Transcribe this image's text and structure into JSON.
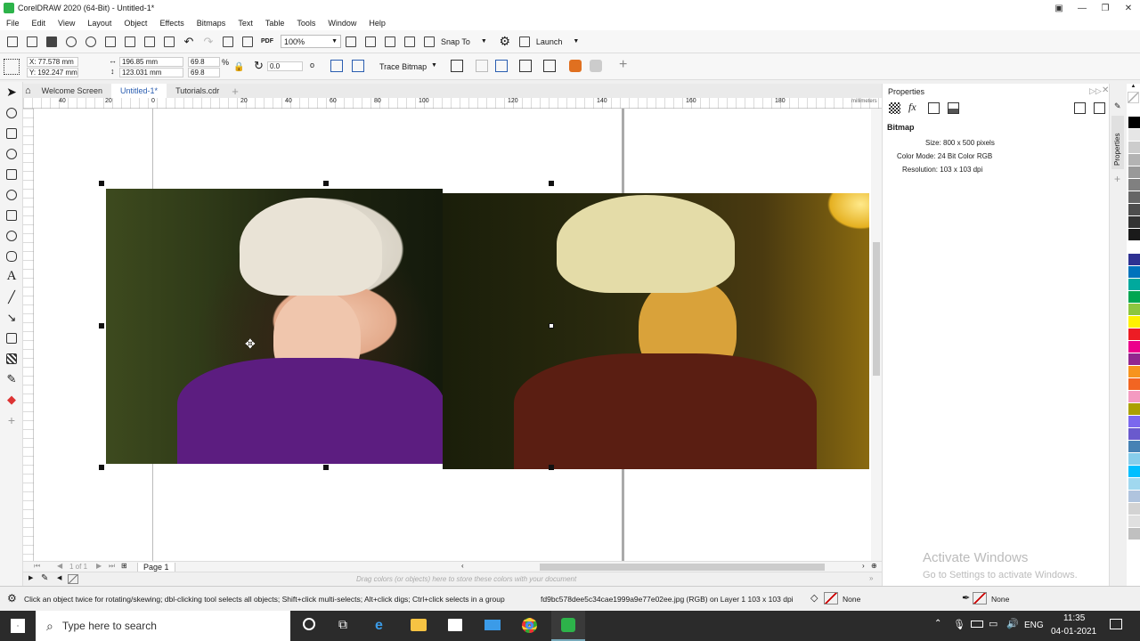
{
  "app": {
    "title": "CorelDRAW 2020 (64-Bit) - Untitled-1*"
  },
  "menu": [
    "File",
    "Edit",
    "View",
    "Layout",
    "Object",
    "Effects",
    "Bitmaps",
    "Text",
    "Table",
    "Tools",
    "Window",
    "Help"
  ],
  "standard_toolbar": {
    "zoom": "100%",
    "snap_to": "Snap To",
    "launch": "Launch"
  },
  "property_bar": {
    "x": "X: 77.578 mm",
    "y": "Y: 192.247 mm",
    "width": "196.85 mm",
    "height": "123.031 mm",
    "scale_w": "69.8",
    "scale_h": "69.8",
    "percent": "%",
    "rotation": "0.0",
    "rotation_unit": "o",
    "trace_bitmap": "Trace Bitmap"
  },
  "document_tabs": [
    "Welcome Screen",
    "Untitled-1*",
    "Tutorials.cdr"
  ],
  "active_tab_index": 1,
  "ruler": {
    "top_ticks": [
      "40",
      "20",
      "0",
      "20",
      "40",
      "60",
      "80",
      "100",
      "120",
      "140",
      "160",
      "180"
    ],
    "units": "millimeters"
  },
  "page_nav": {
    "count_text": "1  of  1",
    "page_label": "Page 1"
  },
  "color_hint": "Drag colors (or objects) here to store these colors with your document",
  "properties_panel": {
    "title": "Properties",
    "section": "Bitmap",
    "size": "Size: 800 x 500 pixels",
    "color_mode": "Color Mode: 24 Bit Color  RGB",
    "resolution": "Resolution: 103 x 103 dpi",
    "side_tab": "Properties"
  },
  "watermark": {
    "line1": "Activate Windows",
    "line2": "Go to Settings to activate Windows."
  },
  "status": {
    "hint": "Click an object twice for rotating/skewing; dbl-clicking tool selects all objects; Shift+click multi-selects; Alt+click digs; Ctrl+click selects in a group",
    "object_info": "fd9bc578dee5c34cae1999a9e77e02ee.jpg (RGB) on Layer 1 103 x 103 dpi",
    "fill": "None",
    "outline": "None"
  },
  "taskbar": {
    "search_placeholder": "Type here to search",
    "language": "ENG",
    "time": "11:35",
    "date": "04-01-2021"
  },
  "palette_colors": [
    "#ffffff",
    "#000000",
    "#e6e6e6",
    "#cccccc",
    "#b3b3b3",
    "#999999",
    "#808080",
    "#666666",
    "#4d4d4d",
    "#333333",
    "#1a1a1a",
    "#ffffff",
    "#2e3192",
    "#0072bc",
    "#00a99d",
    "#00a651",
    "#8dc63f",
    "#fff200",
    "#ed1c24",
    "#ec008c",
    "#92278f",
    "#f7941d",
    "#f26522",
    "#f49ac1",
    "#aba000",
    "#7b68ee",
    "#6a5acd",
    "#4682b4",
    "#87ceeb",
    "#00bfff",
    "#a0d8ef",
    "#b0c4de",
    "#d3d3d3",
    "#e0e0e0",
    "#c0c0c0"
  ]
}
